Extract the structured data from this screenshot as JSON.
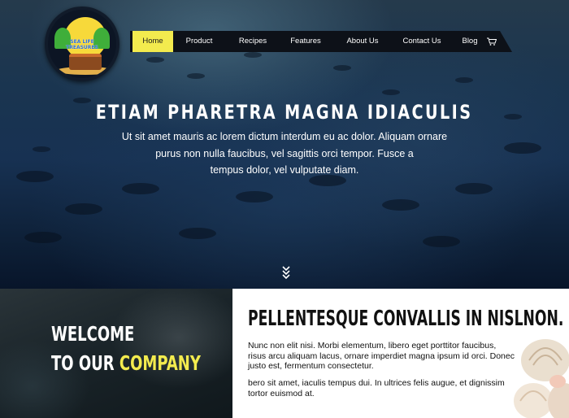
{
  "brand": {
    "logo_text_line1": "SEA LIFE",
    "logo_text_line2": "TREASURES"
  },
  "nav": {
    "items": [
      {
        "label": "Home",
        "active": true
      },
      {
        "label": "Product",
        "active": false
      },
      {
        "label": "Recipes",
        "active": false
      },
      {
        "label": "Features",
        "active": false
      },
      {
        "label": "About Us",
        "active": false
      },
      {
        "label": "Contact Us",
        "active": false
      },
      {
        "label": "Blog",
        "active": false
      }
    ],
    "cart_icon": "cart-icon",
    "active_color": "#f3eb4e"
  },
  "hero": {
    "title": "ETIAM PHARETRA MAGNA IDIACULIS",
    "subtitle_lines": [
      "Ut sit amet mauris ac lorem dictum interdum eu ac dolor. Aliquam ornare",
      "purus non nulla faucibus, vel sagittis orci tempor. Fusce a",
      "tempus dolor, vel vulputate diam."
    ],
    "scroll_icon": "chevron-down-double-icon"
  },
  "welcome": {
    "line1": "WELCOME",
    "line2_prefix": "TO OUR",
    "line2_accent": "COMPANY"
  },
  "content": {
    "title": "PELLENTESQUE CONVALLIS IN NISLNON.",
    "paragraph1": "Nunc non elit nisi. Morbi elementum, libero eget porttitor faucibus, risus arcu aliquam lacus, ornare imperdiet magna ipsum id orci. Donec justo est, fermentum consectetur.",
    "paragraph2": "bero sit amet, iaculis tempus dui. In ultrices felis augue, et dignissim tortor euismod at."
  }
}
